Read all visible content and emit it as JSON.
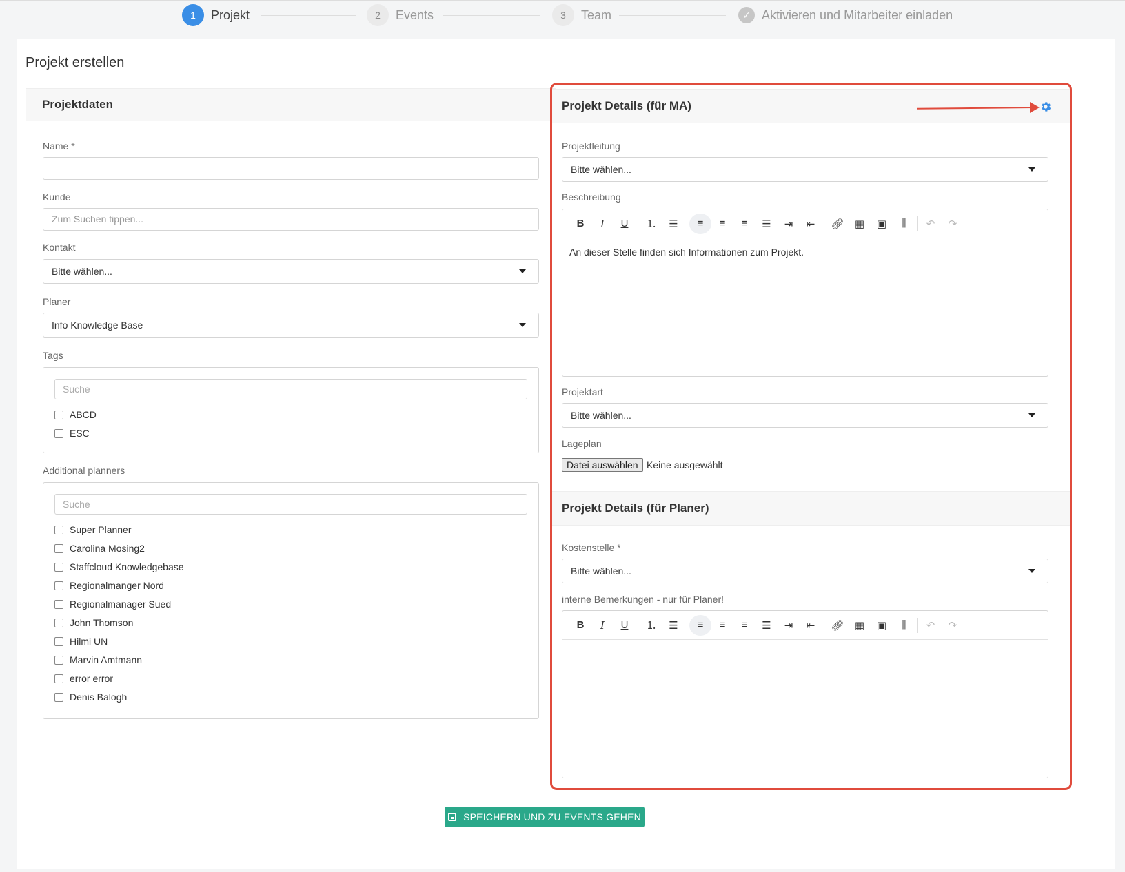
{
  "stepper": {
    "steps": [
      {
        "num": "1",
        "label": "Projekt",
        "state": "active"
      },
      {
        "num": "2",
        "label": "Events",
        "state": "pending"
      },
      {
        "num": "3",
        "label": "Team",
        "state": "pending"
      },
      {
        "num": "✓",
        "label": "Aktivieren und Mitarbeiter einladen",
        "state": "pending"
      }
    ]
  },
  "page": {
    "title": "Projekt erstellen"
  },
  "left": {
    "section_title": "Projektdaten",
    "name_label": "Name *",
    "name_value": "",
    "kunde_label": "Kunde",
    "kunde_placeholder": "Zum Suchen tippen...",
    "kontakt_label": "Kontakt",
    "kontakt_value": "Bitte wählen...",
    "planer_label": "Planer",
    "planer_value": "Info Knowledge Base",
    "tags_label": "Tags",
    "tags_search": "Suche",
    "tags": [
      "ABCD",
      "ESC"
    ],
    "planners_label": "Additional planners",
    "planners_search": "Suche",
    "planners": [
      "Super Planner",
      "Carolina Mosing2",
      "Staffcloud Knowledgebase",
      "Regionalmanger Nord",
      "Regionalmanager Sued",
      "John Thomson",
      "Hilmi UN",
      "Marvin Amtmann",
      "error error",
      "Denis Balogh"
    ]
  },
  "right": {
    "ma_title": "Projekt Details (für MA)",
    "projektleitung_label": "Projektleitung",
    "projektleitung_value": "Bitte wählen...",
    "beschreibung_label": "Beschreibung",
    "beschreibung_text": "An dieser Stelle finden sich Informationen zum Projekt.",
    "projektart_label": "Projektart",
    "projektart_value": "Bitte wählen...",
    "lageplan_label": "Lageplan",
    "file_button": "Datei auswählen",
    "file_status": "Keine ausgewählt",
    "planer_title": "Projekt Details (für Planer)",
    "kostenstelle_label": "Kostenstelle *",
    "kostenstelle_value": "Bitte wählen...",
    "bemerkungen_label": "interne Bemerkungen - nur für Planer!",
    "toolbar": {
      "bold": "B",
      "italic": "I",
      "underline": "U"
    }
  },
  "footer": {
    "save_label": "SPEICHERN UND ZU EVENTS GEHEN"
  },
  "colors": {
    "accent": "#3a8ee6",
    "highlight": "#e04b3c",
    "save": "#2aa88a"
  }
}
